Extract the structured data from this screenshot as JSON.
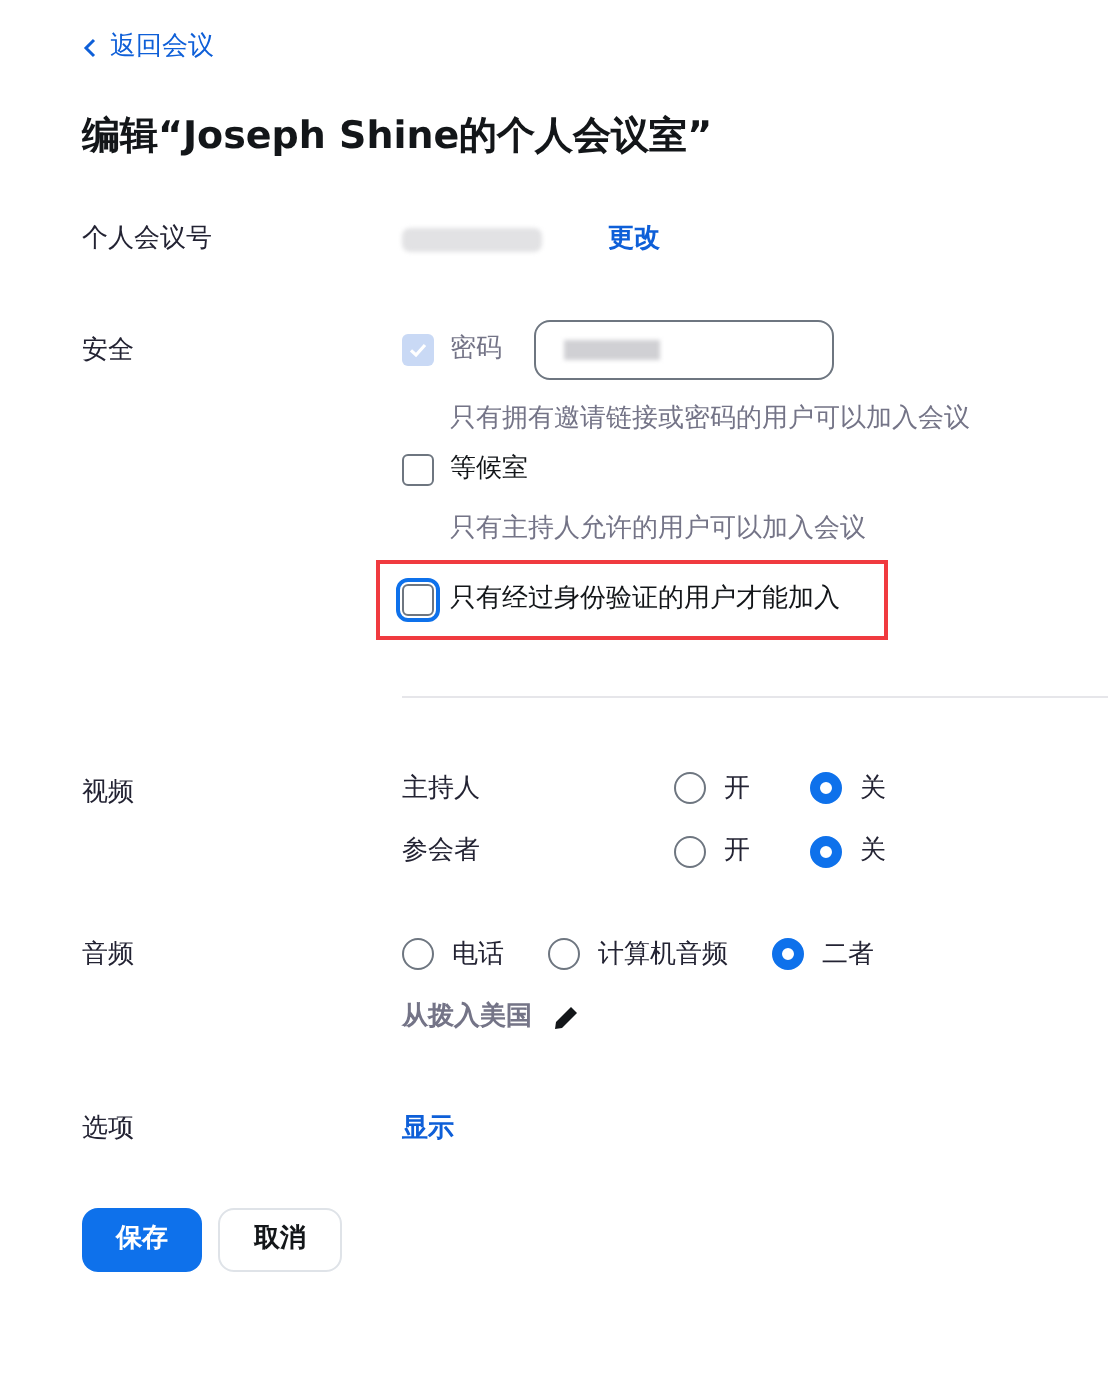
{
  "back_link": "返回会议",
  "title": "编辑“Joseph Shine的个人会议室”",
  "meeting_id": {
    "label": "个人会议号",
    "change_link": "更改"
  },
  "security": {
    "label": "安全",
    "options": [
      {
        "kind": "password",
        "label": "密码",
        "checked": true,
        "disabled": true,
        "hint": "只有拥有邀请链接或密码的用户可以加入会议",
        "highlighted": false
      },
      {
        "kind": "checkbox",
        "label": "等候室",
        "checked": false,
        "disabled": false,
        "hint": "只有主持人允许的用户可以加入会议",
        "highlighted": false
      },
      {
        "kind": "checkbox",
        "label": "只有经过身份验证的用户才能加入",
        "checked": false,
        "disabled": false,
        "highlighted": true
      }
    ]
  },
  "video": {
    "label": "视频",
    "rows": [
      {
        "label": "主持人",
        "options": [
          {
            "label": "开",
            "selected": false
          },
          {
            "label": "关",
            "selected": true
          }
        ]
      },
      {
        "label": "参会者",
        "options": [
          {
            "label": "开",
            "selected": false
          },
          {
            "label": "关",
            "selected": true
          }
        ]
      }
    ]
  },
  "audio": {
    "label": "音频",
    "options": [
      {
        "label": "电话",
        "selected": false
      },
      {
        "label": "计算机音频",
        "selected": false
      },
      {
        "label": "二者",
        "selected": true
      }
    ],
    "dial_in": "从拨入美国"
  },
  "options": {
    "label": "选项",
    "show_link": "显示"
  },
  "buttons": [
    {
      "label": "保存",
      "kind": "primary"
    },
    {
      "label": "取消",
      "kind": "secondary"
    }
  ]
}
